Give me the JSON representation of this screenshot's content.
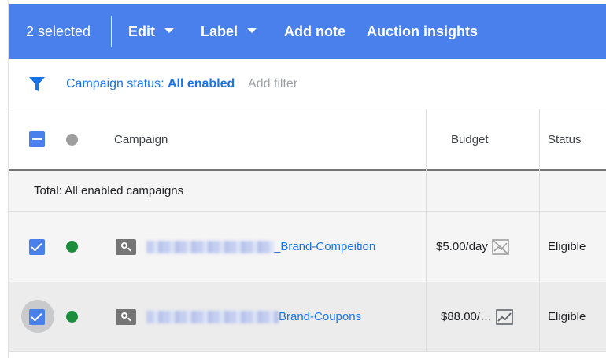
{
  "toolbar": {
    "selection_label": "2 selected",
    "edit_label": "Edit",
    "label_label": "Label",
    "add_note_label": "Add note",
    "auction_insights_label": "Auction insights",
    "background_color": "#4a80eb"
  },
  "filter_bar": {
    "icon": "filter-icon",
    "status_prefix": "Campaign status: ",
    "status_value": "All enabled",
    "add_filter_label": "Add filter"
  },
  "table": {
    "columns": [
      "Campaign",
      "Budget",
      "Status"
    ],
    "total_label": "Total: All enabled campaigns",
    "rows": [
      {
        "selected": true,
        "status_dot_color": "#1e8e3e",
        "type_icon": "search-icon",
        "campaign_name_visible": "_Brand-Compeition",
        "budget": "$5.00/day",
        "trend_icon": "no-data-chart-icon",
        "status": "Eligible"
      },
      {
        "selected": true,
        "status_dot_color": "#1e8e3e",
        "type_icon": "search-icon",
        "campaign_name_visible": "Brand-Coupons",
        "budget": "$88.00/…",
        "trend_icon": "line-chart-icon",
        "status": "Eligible"
      }
    ]
  }
}
